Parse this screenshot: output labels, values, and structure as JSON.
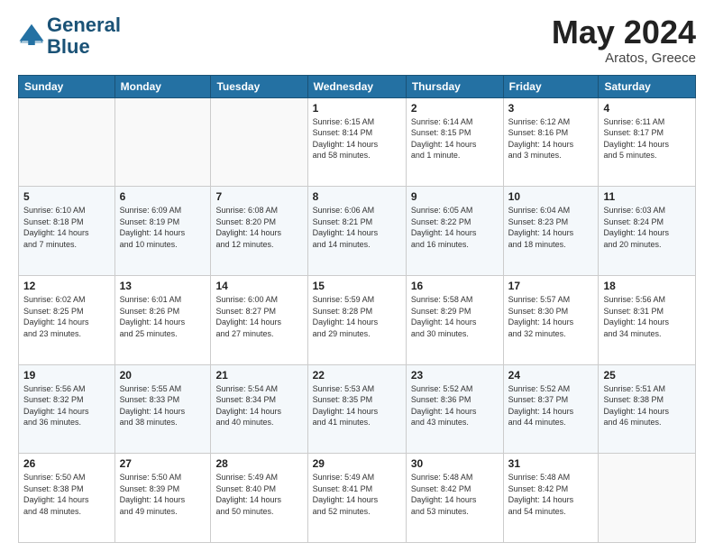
{
  "header": {
    "title": "May 2024",
    "subtitle": "Aratos, Greece",
    "logo": "GeneralBlue"
  },
  "calendar": {
    "headers": [
      "Sunday",
      "Monday",
      "Tuesday",
      "Wednesday",
      "Thursday",
      "Friday",
      "Saturday"
    ],
    "weeks": [
      [
        {
          "day": "",
          "info": ""
        },
        {
          "day": "",
          "info": ""
        },
        {
          "day": "",
          "info": ""
        },
        {
          "day": "1",
          "info": "Sunrise: 6:15 AM\nSunset: 8:14 PM\nDaylight: 14 hours\nand 58 minutes."
        },
        {
          "day": "2",
          "info": "Sunrise: 6:14 AM\nSunset: 8:15 PM\nDaylight: 14 hours\nand 1 minute."
        },
        {
          "day": "3",
          "info": "Sunrise: 6:12 AM\nSunset: 8:16 PM\nDaylight: 14 hours\nand 3 minutes."
        },
        {
          "day": "4",
          "info": "Sunrise: 6:11 AM\nSunset: 8:17 PM\nDaylight: 14 hours\nand 5 minutes."
        }
      ],
      [
        {
          "day": "5",
          "info": "Sunrise: 6:10 AM\nSunset: 8:18 PM\nDaylight: 14 hours\nand 7 minutes."
        },
        {
          "day": "6",
          "info": "Sunrise: 6:09 AM\nSunset: 8:19 PM\nDaylight: 14 hours\nand 10 minutes."
        },
        {
          "day": "7",
          "info": "Sunrise: 6:08 AM\nSunset: 8:20 PM\nDaylight: 14 hours\nand 12 minutes."
        },
        {
          "day": "8",
          "info": "Sunrise: 6:06 AM\nSunset: 8:21 PM\nDaylight: 14 hours\nand 14 minutes."
        },
        {
          "day": "9",
          "info": "Sunrise: 6:05 AM\nSunset: 8:22 PM\nDaylight: 14 hours\nand 16 minutes."
        },
        {
          "day": "10",
          "info": "Sunrise: 6:04 AM\nSunset: 8:23 PM\nDaylight: 14 hours\nand 18 minutes."
        },
        {
          "day": "11",
          "info": "Sunrise: 6:03 AM\nSunset: 8:24 PM\nDaylight: 14 hours\nand 20 minutes."
        }
      ],
      [
        {
          "day": "12",
          "info": "Sunrise: 6:02 AM\nSunset: 8:25 PM\nDaylight: 14 hours\nand 23 minutes."
        },
        {
          "day": "13",
          "info": "Sunrise: 6:01 AM\nSunset: 8:26 PM\nDaylight: 14 hours\nand 25 minutes."
        },
        {
          "day": "14",
          "info": "Sunrise: 6:00 AM\nSunset: 8:27 PM\nDaylight: 14 hours\nand 27 minutes."
        },
        {
          "day": "15",
          "info": "Sunrise: 5:59 AM\nSunset: 8:28 PM\nDaylight: 14 hours\nand 29 minutes."
        },
        {
          "day": "16",
          "info": "Sunrise: 5:58 AM\nSunset: 8:29 PM\nDaylight: 14 hours\nand 30 minutes."
        },
        {
          "day": "17",
          "info": "Sunrise: 5:57 AM\nSunset: 8:30 PM\nDaylight: 14 hours\nand 32 minutes."
        },
        {
          "day": "18",
          "info": "Sunrise: 5:56 AM\nSunset: 8:31 PM\nDaylight: 14 hours\nand 34 minutes."
        }
      ],
      [
        {
          "day": "19",
          "info": "Sunrise: 5:56 AM\nSunset: 8:32 PM\nDaylight: 14 hours\nand 36 minutes."
        },
        {
          "day": "20",
          "info": "Sunrise: 5:55 AM\nSunset: 8:33 PM\nDaylight: 14 hours\nand 38 minutes."
        },
        {
          "day": "21",
          "info": "Sunrise: 5:54 AM\nSunset: 8:34 PM\nDaylight: 14 hours\nand 40 minutes."
        },
        {
          "day": "22",
          "info": "Sunrise: 5:53 AM\nSunset: 8:35 PM\nDaylight: 14 hours\nand 41 minutes."
        },
        {
          "day": "23",
          "info": "Sunrise: 5:52 AM\nSunset: 8:36 PM\nDaylight: 14 hours\nand 43 minutes."
        },
        {
          "day": "24",
          "info": "Sunrise: 5:52 AM\nSunset: 8:37 PM\nDaylight: 14 hours\nand 44 minutes."
        },
        {
          "day": "25",
          "info": "Sunrise: 5:51 AM\nSunset: 8:38 PM\nDaylight: 14 hours\nand 46 minutes."
        }
      ],
      [
        {
          "day": "26",
          "info": "Sunrise: 5:50 AM\nSunset: 8:38 PM\nDaylight: 14 hours\nand 48 minutes."
        },
        {
          "day": "27",
          "info": "Sunrise: 5:50 AM\nSunset: 8:39 PM\nDaylight: 14 hours\nand 49 minutes."
        },
        {
          "day": "28",
          "info": "Sunrise: 5:49 AM\nSunset: 8:40 PM\nDaylight: 14 hours\nand 50 minutes."
        },
        {
          "day": "29",
          "info": "Sunrise: 5:49 AM\nSunset: 8:41 PM\nDaylight: 14 hours\nand 52 minutes."
        },
        {
          "day": "30",
          "info": "Sunrise: 5:48 AM\nSunset: 8:42 PM\nDaylight: 14 hours\nand 53 minutes."
        },
        {
          "day": "31",
          "info": "Sunrise: 5:48 AM\nSunset: 8:42 PM\nDaylight: 14 hours\nand 54 minutes."
        },
        {
          "day": "",
          "info": ""
        }
      ]
    ]
  }
}
